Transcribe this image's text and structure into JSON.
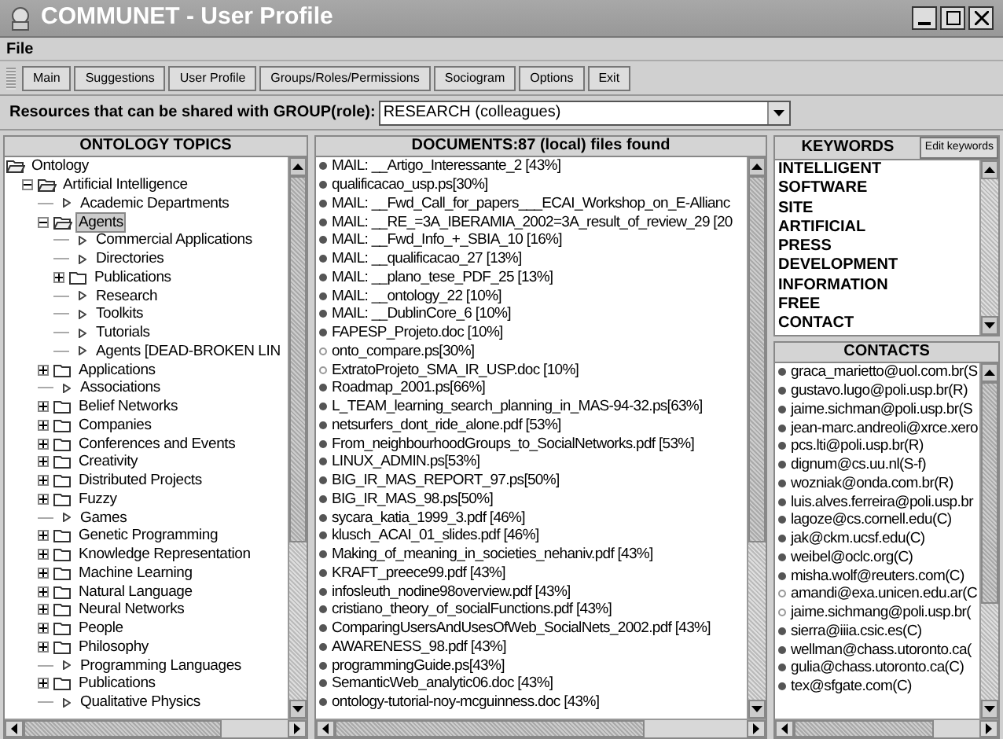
{
  "window": {
    "title": "COMMUNET - User Profile"
  },
  "menu": [
    "File"
  ],
  "toolbar": [
    "Main",
    "Suggestions",
    "User Profile",
    "Groups/Roles/Permissions",
    "Sociogram",
    "Options",
    "Exit"
  ],
  "resources": {
    "label": "Resources that can be shared with GROUP(role):",
    "value": "RESEARCH (colleagues)"
  },
  "ontology": {
    "title": "ONTOLOGY TOPICS",
    "tree": [
      {
        "label": "Ontology",
        "kind": "folder",
        "expanded": true,
        "selected": false,
        "children": [
          {
            "label": "Artificial Intelligence",
            "kind": "folder",
            "expanded": true,
            "selected": false,
            "children": [
              {
                "label": "Academic Departments",
                "kind": "leaf"
              },
              {
                "label": "Agents",
                "kind": "folder",
                "expanded": true,
                "selected": true,
                "children": [
                  {
                    "label": "Commercial Applications",
                    "kind": "leaf"
                  },
                  {
                    "label": "Directories",
                    "kind": "leaf"
                  },
                  {
                    "label": "Publications",
                    "kind": "folder",
                    "expanded": false,
                    "selected": false
                  },
                  {
                    "label": "Research",
                    "kind": "leaf"
                  },
                  {
                    "label": "Toolkits",
                    "kind": "leaf"
                  },
                  {
                    "label": "Tutorials",
                    "kind": "leaf"
                  },
                  {
                    "label": "Agents [DEAD-BROKEN LIN",
                    "kind": "leaf"
                  }
                ]
              },
              {
                "label": "Applications",
                "kind": "folder",
                "expanded": false,
                "selected": false
              },
              {
                "label": "Associations",
                "kind": "leaf"
              },
              {
                "label": "Belief Networks",
                "kind": "folder",
                "expanded": false,
                "selected": false
              },
              {
                "label": "Companies",
                "kind": "folder",
                "expanded": false,
                "selected": false
              },
              {
                "label": "Conferences and Events",
                "kind": "folder",
                "expanded": false,
                "selected": false
              },
              {
                "label": "Creativity",
                "kind": "folder",
                "expanded": false,
                "selected": false
              },
              {
                "label": "Distributed Projects",
                "kind": "folder",
                "expanded": false,
                "selected": false
              },
              {
                "label": "Fuzzy",
                "kind": "folder",
                "expanded": false,
                "selected": false
              },
              {
                "label": "Games",
                "kind": "leaf"
              },
              {
                "label": "Genetic Programming",
                "kind": "folder",
                "expanded": false,
                "selected": false
              },
              {
                "label": "Knowledge Representation",
                "kind": "folder",
                "expanded": false,
                "selected": false
              },
              {
                "label": "Machine Learning",
                "kind": "folder",
                "expanded": false,
                "selected": false
              },
              {
                "label": "Natural Language",
                "kind": "folder",
                "expanded": false,
                "selected": false
              },
              {
                "label": "Neural Networks",
                "kind": "folder",
                "expanded": false,
                "selected": false
              },
              {
                "label": "People",
                "kind": "folder",
                "expanded": false,
                "selected": false
              },
              {
                "label": "Philosophy",
                "kind": "folder",
                "expanded": false,
                "selected": false
              },
              {
                "label": "Programming Languages",
                "kind": "leaf"
              },
              {
                "label": "Publications",
                "kind": "folder",
                "expanded": false,
                "selected": false
              },
              {
                "label": "Qualitative Physics",
                "kind": "leaf"
              }
            ]
          }
        ]
      }
    ]
  },
  "documents": {
    "title": "DOCUMENTS:87 (local) files found",
    "items": [
      {
        "label": "MAIL: __Artigo_Interessante_2 [43%]",
        "kind": "filled"
      },
      {
        "label": "qualificacao_usp.ps[30%]",
        "kind": "filled"
      },
      {
        "label": "MAIL: __Fwd_Call_for_papers___ECAI_Workshop_on_E-Allianc",
        "kind": "filled"
      },
      {
        "label": "MAIL: __RE_=3A_IBERAMIA_2002=3A_result_of_review_29 [20",
        "kind": "filled"
      },
      {
        "label": "MAIL: __Fwd_Info_+_SBIA_10 [16%]",
        "kind": "filled"
      },
      {
        "label": "MAIL: __qualificacao_27 [13%]",
        "kind": "filled"
      },
      {
        "label": "MAIL: __plano_tese_PDF_25 [13%]",
        "kind": "filled"
      },
      {
        "label": "MAIL: __ontology_22 [10%]",
        "kind": "filled"
      },
      {
        "label": "MAIL: __DublinCore_6 [10%]",
        "kind": "filled"
      },
      {
        "label": "FAPESP_Projeto.doc [10%]",
        "kind": "filled"
      },
      {
        "label": "onto_compare.ps[30%]",
        "kind": "hollow"
      },
      {
        "label": "ExtratoProjeto_SMA_IR_USP.doc [10%]",
        "kind": "hollow"
      },
      {
        "label": "Roadmap_2001.ps[66%]",
        "kind": "filled"
      },
      {
        "label": "L_TEAM_learning_search_planning_in_MAS-94-32.ps[63%]",
        "kind": "filled"
      },
      {
        "label": "netsurfers_dont_ride_alone.pdf [53%]",
        "kind": "filled"
      },
      {
        "label": "From_neighbourhoodGroups_to_SocialNetworks.pdf [53%]",
        "kind": "filled"
      },
      {
        "label": "LINUX_ADMIN.ps[53%]",
        "kind": "filled"
      },
      {
        "label": "BIG_IR_MAS_REPORT_97.ps[50%]",
        "kind": "filled"
      },
      {
        "label": "BIG_IR_MAS_98.ps[50%]",
        "kind": "filled"
      },
      {
        "label": "sycara_katia_1999_3.pdf [46%]",
        "kind": "filled"
      },
      {
        "label": "klusch_ACAI_01_slides.pdf [46%]",
        "kind": "filled"
      },
      {
        "label": "Making_of_meaning_in_societies_nehaniv.pdf [43%]",
        "kind": "filled"
      },
      {
        "label": "KRAFT_preece99.pdf [43%]",
        "kind": "filled"
      },
      {
        "label": "infosleuth_nodine98overview.pdf [43%]",
        "kind": "filled"
      },
      {
        "label": "cristiano_theory_of_socialFunctions.pdf [43%]",
        "kind": "filled"
      },
      {
        "label": "ComparingUsersAndUsesOfWeb_SocialNets_2002.pdf [43%]",
        "kind": "filled"
      },
      {
        "label": "AWARENESS_98.pdf [43%]",
        "kind": "filled"
      },
      {
        "label": "programmingGuide.ps[43%]",
        "kind": "filled"
      },
      {
        "label": "SemanticWeb_analytic06.doc [43%]",
        "kind": "filled"
      },
      {
        "label": "ontology-tutorial-noy-mcguinness.doc [43%]",
        "kind": "filled"
      }
    ]
  },
  "keywords": {
    "title": "KEYWORDS",
    "edit_button": "Edit keywords",
    "items": [
      "INTELLIGENT",
      "SOFTWARE",
      "SITE",
      "ARTIFICIAL",
      "PRESS",
      "DEVELOPMENT",
      "INFORMATION",
      "FREE",
      "CONTACT"
    ]
  },
  "contacts": {
    "title": "CONTACTS",
    "items": [
      {
        "label": "graca_marietto@uol.com.br(S",
        "kind": "filled"
      },
      {
        "label": "gustavo.lugo@poli.usp.br(R)",
        "kind": "filled"
      },
      {
        "label": "jaime.sichman@poli.usp.br(S",
        "kind": "filled"
      },
      {
        "label": "jean-marc.andreoli@xrce.xero",
        "kind": "filled"
      },
      {
        "label": "pcs.lti@poli.usp.br(R)",
        "kind": "filled"
      },
      {
        "label": "dignum@cs.uu.nl(S-f)",
        "kind": "filled"
      },
      {
        "label": "wozniak@onda.com.br(R)",
        "kind": "filled"
      },
      {
        "label": "luis.alves.ferreira@poli.usp.br",
        "kind": "filled"
      },
      {
        "label": "lagoze@cs.cornell.edu(C)",
        "kind": "filled"
      },
      {
        "label": "jak@ckm.ucsf.edu(C)",
        "kind": "filled"
      },
      {
        "label": "weibel@oclc.org(C)",
        "kind": "filled"
      },
      {
        "label": "misha.wolf@reuters.com(C)",
        "kind": "filled"
      },
      {
        "label": "amandi@exa.unicen.edu.ar(C",
        "kind": "hollow"
      },
      {
        "label": "jaime.sichmang@poli.usp.br(",
        "kind": "hollow"
      },
      {
        "label": "sierra@iiia.csic.es(C)",
        "kind": "filled"
      },
      {
        "label": "wellman@chass.utoronto.ca(",
        "kind": "filled"
      },
      {
        "label": "gulia@chass.utoronto.ca(C)",
        "kind": "filled"
      },
      {
        "label": "tex@sfgate.com(C)",
        "kind": "filled"
      }
    ]
  }
}
